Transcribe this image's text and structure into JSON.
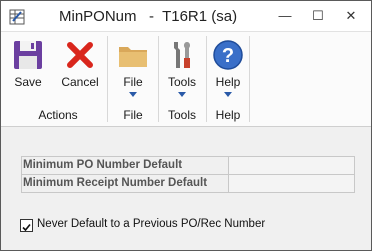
{
  "window": {
    "title": "MinPONum   -  T16R1 (sa)",
    "controls": {
      "minimize": "—",
      "maximize": "☐",
      "close": "✕"
    }
  },
  "ribbon": {
    "groups": [
      {
        "label": "Actions",
        "buttons": [
          {
            "label": "Save",
            "icon": "floppy-disk-icon"
          },
          {
            "label": "Cancel",
            "icon": "red-x-icon"
          }
        ]
      },
      {
        "label": "File",
        "buttons": [
          {
            "label": "File",
            "icon": "folder-icon",
            "dropdown": true
          }
        ]
      },
      {
        "label": "Tools",
        "buttons": [
          {
            "label": "Tools",
            "icon": "tools-icon",
            "dropdown": true
          }
        ]
      },
      {
        "label": "Help",
        "buttons": [
          {
            "label": "Help",
            "icon": "help-question-icon",
            "dropdown": true
          }
        ]
      }
    ]
  },
  "form": {
    "fields": [
      {
        "label": "Minimum PO Number Default",
        "value": ""
      },
      {
        "label": "Minimum Receipt Number Default",
        "value": ""
      }
    ],
    "checkbox": {
      "label": "Never Default to a Previous PO/Rec Number",
      "checked": true
    }
  },
  "colors": {
    "accent_blue": "#2a5aa8",
    "cancel_red": "#d9261c",
    "folder_tan": "#d9a85a",
    "help_blue": "#3a6fc8"
  }
}
